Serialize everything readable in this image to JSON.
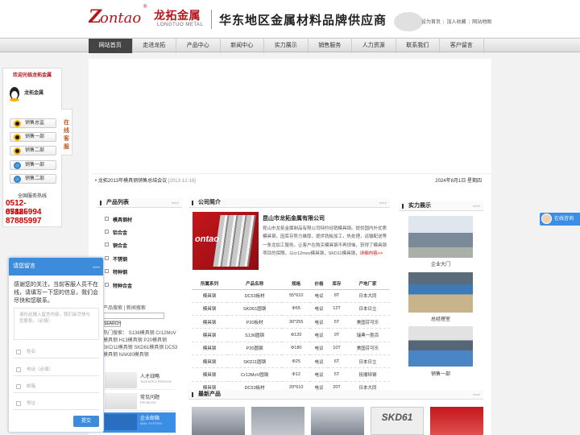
{
  "header": {
    "logo_text": "ontao",
    "reg_mark": "®",
    "brand_cn": "龙拓金属",
    "brand_en": "LONGTUO METAL",
    "slogan": "华东地区金属材料品牌供应商",
    "links": [
      "设为首页",
      "加入收藏",
      "网站地图"
    ]
  },
  "nav": {
    "items": [
      "网站首页",
      "走进龙拓",
      "产品中心",
      "新闻中心",
      "实力展示",
      "销售服务",
      "人力资源",
      "联系我们",
      "客户留言"
    ],
    "active_index": 0
  },
  "left_panel": {
    "title": "欢迎光临龙拓金属",
    "logo_text": "龙拓金属",
    "buttons": [
      {
        "label": "销售总监",
        "icon": "qq-icon"
      },
      {
        "label": "销售一部",
        "icon": "qq-icon"
      },
      {
        "label": "销售二部",
        "icon": "qq-icon"
      },
      {
        "label": "销售一部",
        "icon": "wangwang-icon"
      },
      {
        "label": "销售二部",
        "icon": "wangwang-icon"
      }
    ],
    "hotline_label": "全国服务热线",
    "hotlines": [
      "0512-87885994",
      "0512-87885997"
    ],
    "online_tab": "在线客服"
  },
  "right_float": {
    "label": "在线咨询"
  },
  "news_bar": {
    "headline": "• 龙拓2013年模具钢销售总结会议",
    "date": "[2013-12-16]",
    "today": "2024年8月1日 星期四"
  },
  "product_list": {
    "title": "产品列表",
    "more": "more",
    "items": [
      "模具钢材",
      "铝合金",
      "铜合金",
      "不锈钢",
      "特种钢",
      "特种合金"
    ],
    "search_tabs": "产品搜索 | 新闻搜索",
    "search_button": "SEARCH",
    "hot_keywords": "热门搜索： S136模具钢 Cr12MoV模具钢 H13模具钢 P20模具钢 SKD11模具钢 SKD61模具钢 DC53模具钢 NAK80模具钢"
  },
  "side_ads": [
    {
      "title": "人才战略",
      "subtitle": "TALENTED PERSON"
    },
    {
      "title": "常见问题",
      "subtitle": "PROBLEM"
    },
    {
      "title": "企业邮箱",
      "subtitle": "MAIL SYSTEM"
    }
  ],
  "about": {
    "title": "公司简介",
    "more": "more",
    "company_name": "昆山市龙拓金属有限公司",
    "text": "昆山市龙拓金属制品有限公司特约经销模具钢。提供国内外优质模具钢，因库存势力雄厚，提供铣板加工，热处理，运输配送等一条龙加工服务。让客户在购买模具钢不再烦恼，获得了模具钢项目的保障。以cr12mov模具钢，SKD11模具钢，",
    "more_link": "详细内容>>",
    "image_text": "ontao"
  },
  "spec_table": {
    "headers": [
      "所属系列",
      "产品名称",
      "规格",
      "价格",
      "库存",
      "产地厂家"
    ],
    "rows": [
      [
        "模具钢",
        "DC53板材",
        "55*610",
        "电议",
        "8T",
        "日本大同"
      ],
      [
        "模具钢",
        "SKD61圆钢",
        "Φ55",
        "电议",
        "12T",
        "日本日立"
      ],
      [
        "模具钢",
        "P20板材",
        "30*255",
        "电议",
        "5T",
        "美国芬可乐"
      ],
      [
        "模具钢",
        "S136圆钢",
        "Φ120",
        "电议",
        "9T",
        "瑞典一胜百"
      ],
      [
        "模具钢",
        "P20圆钢",
        "Φ180",
        "电议",
        "10T",
        "美国芬可乐"
      ],
      [
        "模具钢",
        "SKD11圆钢",
        "Φ25",
        "电议",
        "6T",
        "日本日立"
      ],
      [
        "模具钢",
        "Cr12MoV圆钢",
        "Φ12",
        "电议",
        "5T",
        "抚顺特钢"
      ],
      [
        "模具钢",
        "DC53板材",
        "20*610",
        "电议",
        "20T",
        "日本大同"
      ]
    ]
  },
  "strength": {
    "title": "实力展示",
    "more": "more",
    "items": [
      "企业大门",
      "总经理室",
      "销售一部"
    ]
  },
  "latest": {
    "title": "最新产品",
    "more": "more",
    "img_label": "SKD61"
  },
  "popup": {
    "title": "请您留言",
    "minimize": "—",
    "message": "感谢您的关注，当前客服人员不在线，请填写一下您的信息，我们会尽快和您联系。",
    "textarea_placeholder": "请在此输入留言内容，我们会尽快与您联系。（必填）",
    "fields": [
      "姓名",
      "电话（必填）",
      "邮箱",
      "地址"
    ],
    "submit": "提交"
  },
  "colors": {
    "brand_red": "#b4161b",
    "nav_active": "#444444",
    "popup_blue": "#3d8cdb",
    "hotline_red": "#cc0000"
  }
}
